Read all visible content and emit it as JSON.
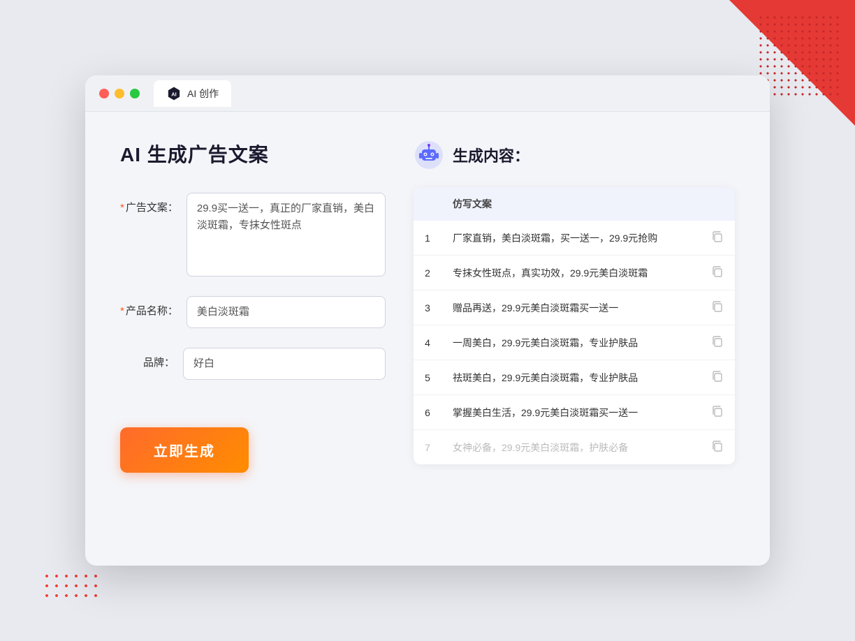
{
  "background": {
    "color": "#e8eaf0"
  },
  "browser": {
    "tab": {
      "icon_label": "AI",
      "title": "AI 创作"
    },
    "traffic_lights": {
      "red": "#ff5f57",
      "yellow": "#febc2e",
      "green": "#28c840"
    }
  },
  "left_panel": {
    "page_title": "AI 生成广告文案",
    "form": {
      "ad_copy_label": "广告文案：",
      "ad_copy_required": "*",
      "ad_copy_value": "29.9买一送一，真正的厂家直销，美白淡斑霜，专抹女性斑点",
      "product_name_label": "产品名称：",
      "product_name_required": "*",
      "product_name_value": "美白淡斑霜",
      "brand_label": "品牌：",
      "brand_value": "好白"
    },
    "generate_button": "立即生成"
  },
  "right_panel": {
    "header_title": "生成内容：",
    "table": {
      "column_header": "仿写文案",
      "rows": [
        {
          "num": "1",
          "text": "厂家直销，美白淡斑霜，买一送一，29.9元抢购",
          "faded": false
        },
        {
          "num": "2",
          "text": "专抹女性斑点，真实功效，29.9元美白淡斑霜",
          "faded": false
        },
        {
          "num": "3",
          "text": "赠品再送，29.9元美白淡斑霜买一送一",
          "faded": false
        },
        {
          "num": "4",
          "text": "一周美白，29.9元美白淡斑霜，专业护肤品",
          "faded": false
        },
        {
          "num": "5",
          "text": "祛斑美白，29.9元美白淡斑霜，专业护肤品",
          "faded": false
        },
        {
          "num": "6",
          "text": "掌握美白生活，29.9元美白淡斑霜买一送一",
          "faded": false
        },
        {
          "num": "7",
          "text": "女神必备，29.9元美白淡斑霜，护肤必备",
          "faded": true
        }
      ]
    }
  }
}
